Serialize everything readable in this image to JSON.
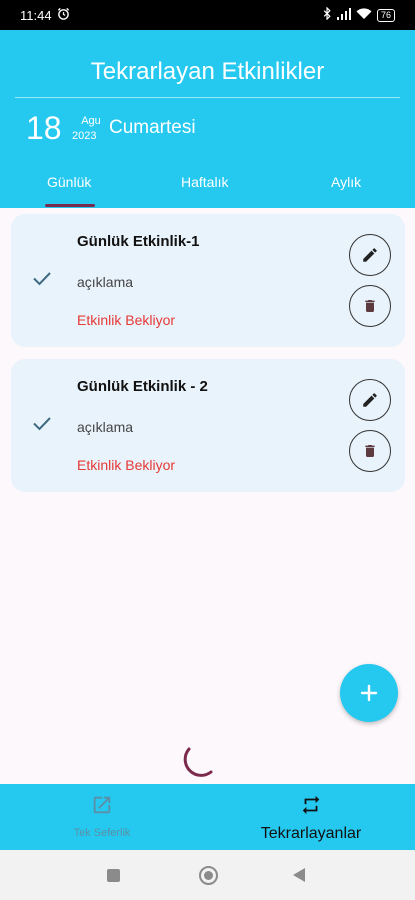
{
  "status_bar": {
    "time": "11:44",
    "battery": "76",
    "icons": [
      "alarm-icon",
      "bluetooth-icon",
      "signal-icon",
      "wifi-icon",
      "battery-icon"
    ]
  },
  "header": {
    "title": "Tekrarlayan Etkinlikler",
    "date": {
      "day": "18",
      "month": "Agu",
      "year": "2023",
      "weekday": "Cumartesi"
    },
    "tabs": [
      {
        "label": "Günlük",
        "selected": true
      },
      {
        "label": "Haftalık",
        "selected": false
      },
      {
        "label": "Aylık",
        "selected": false
      }
    ]
  },
  "events": [
    {
      "name": "Günlük Etkinlik-1",
      "description": "açıklama",
      "status": "Etkinlik Bekliyor"
    },
    {
      "name": "Günlük Etkinlik - 2",
      "description": "açıklama",
      "status": "Etkinlik Bekliyor"
    }
  ],
  "bottom_nav": {
    "items": [
      {
        "label": "Tek Seferlik",
        "icon": "open-in-new-icon",
        "selected": false
      },
      {
        "label": "Tekrarlayanlar",
        "icon": "repeat-icon",
        "selected": true
      }
    ]
  },
  "colors": {
    "primary": "#25c9f0",
    "tab_indicator": "#7c2a4c",
    "status_waiting": "#e53935",
    "card_background": "#e9f3fb",
    "page_background": "#fdf8fc"
  }
}
